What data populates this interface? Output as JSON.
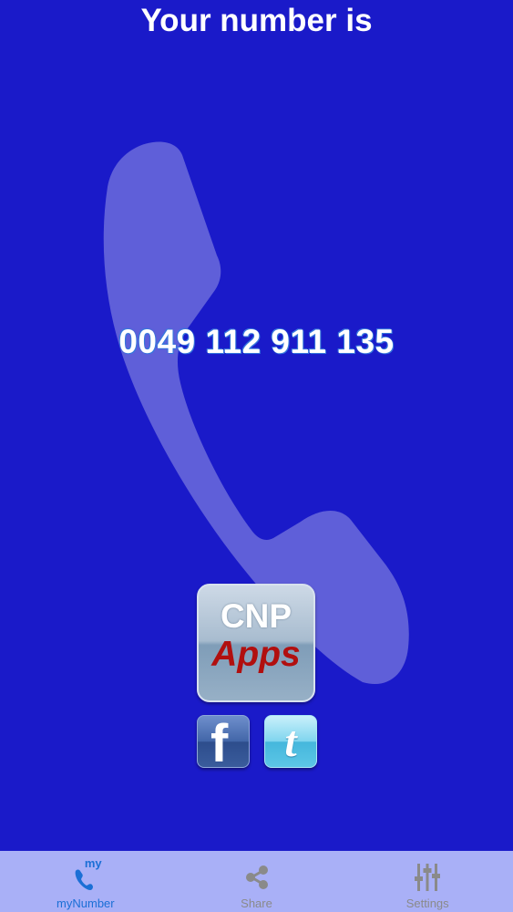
{
  "header": {
    "title": "Your number is"
  },
  "main": {
    "phone_number": "0049 112 911 135",
    "background_icon": "phone-handset-icon",
    "cnp_badge": {
      "line1": "CNP",
      "line2": "Apps"
    },
    "social": [
      {
        "name": "facebook",
        "glyph": "f"
      },
      {
        "name": "twitter",
        "glyph": "t"
      }
    ]
  },
  "tabbar": {
    "tabs": [
      {
        "label": "myNumber",
        "icon": "my-phone-icon",
        "badge": "my",
        "active": true
      },
      {
        "label": "Share",
        "icon": "share-icon",
        "active": false
      },
      {
        "label": "Settings",
        "icon": "sliders-icon",
        "active": false
      }
    ]
  },
  "colors": {
    "background": "#1a1ac9",
    "tabbar": "#a9b0f7",
    "active_tab": "#1b6fd6",
    "inactive_tab": "#8a8a8a",
    "apps_text": "#b10f0f"
  }
}
